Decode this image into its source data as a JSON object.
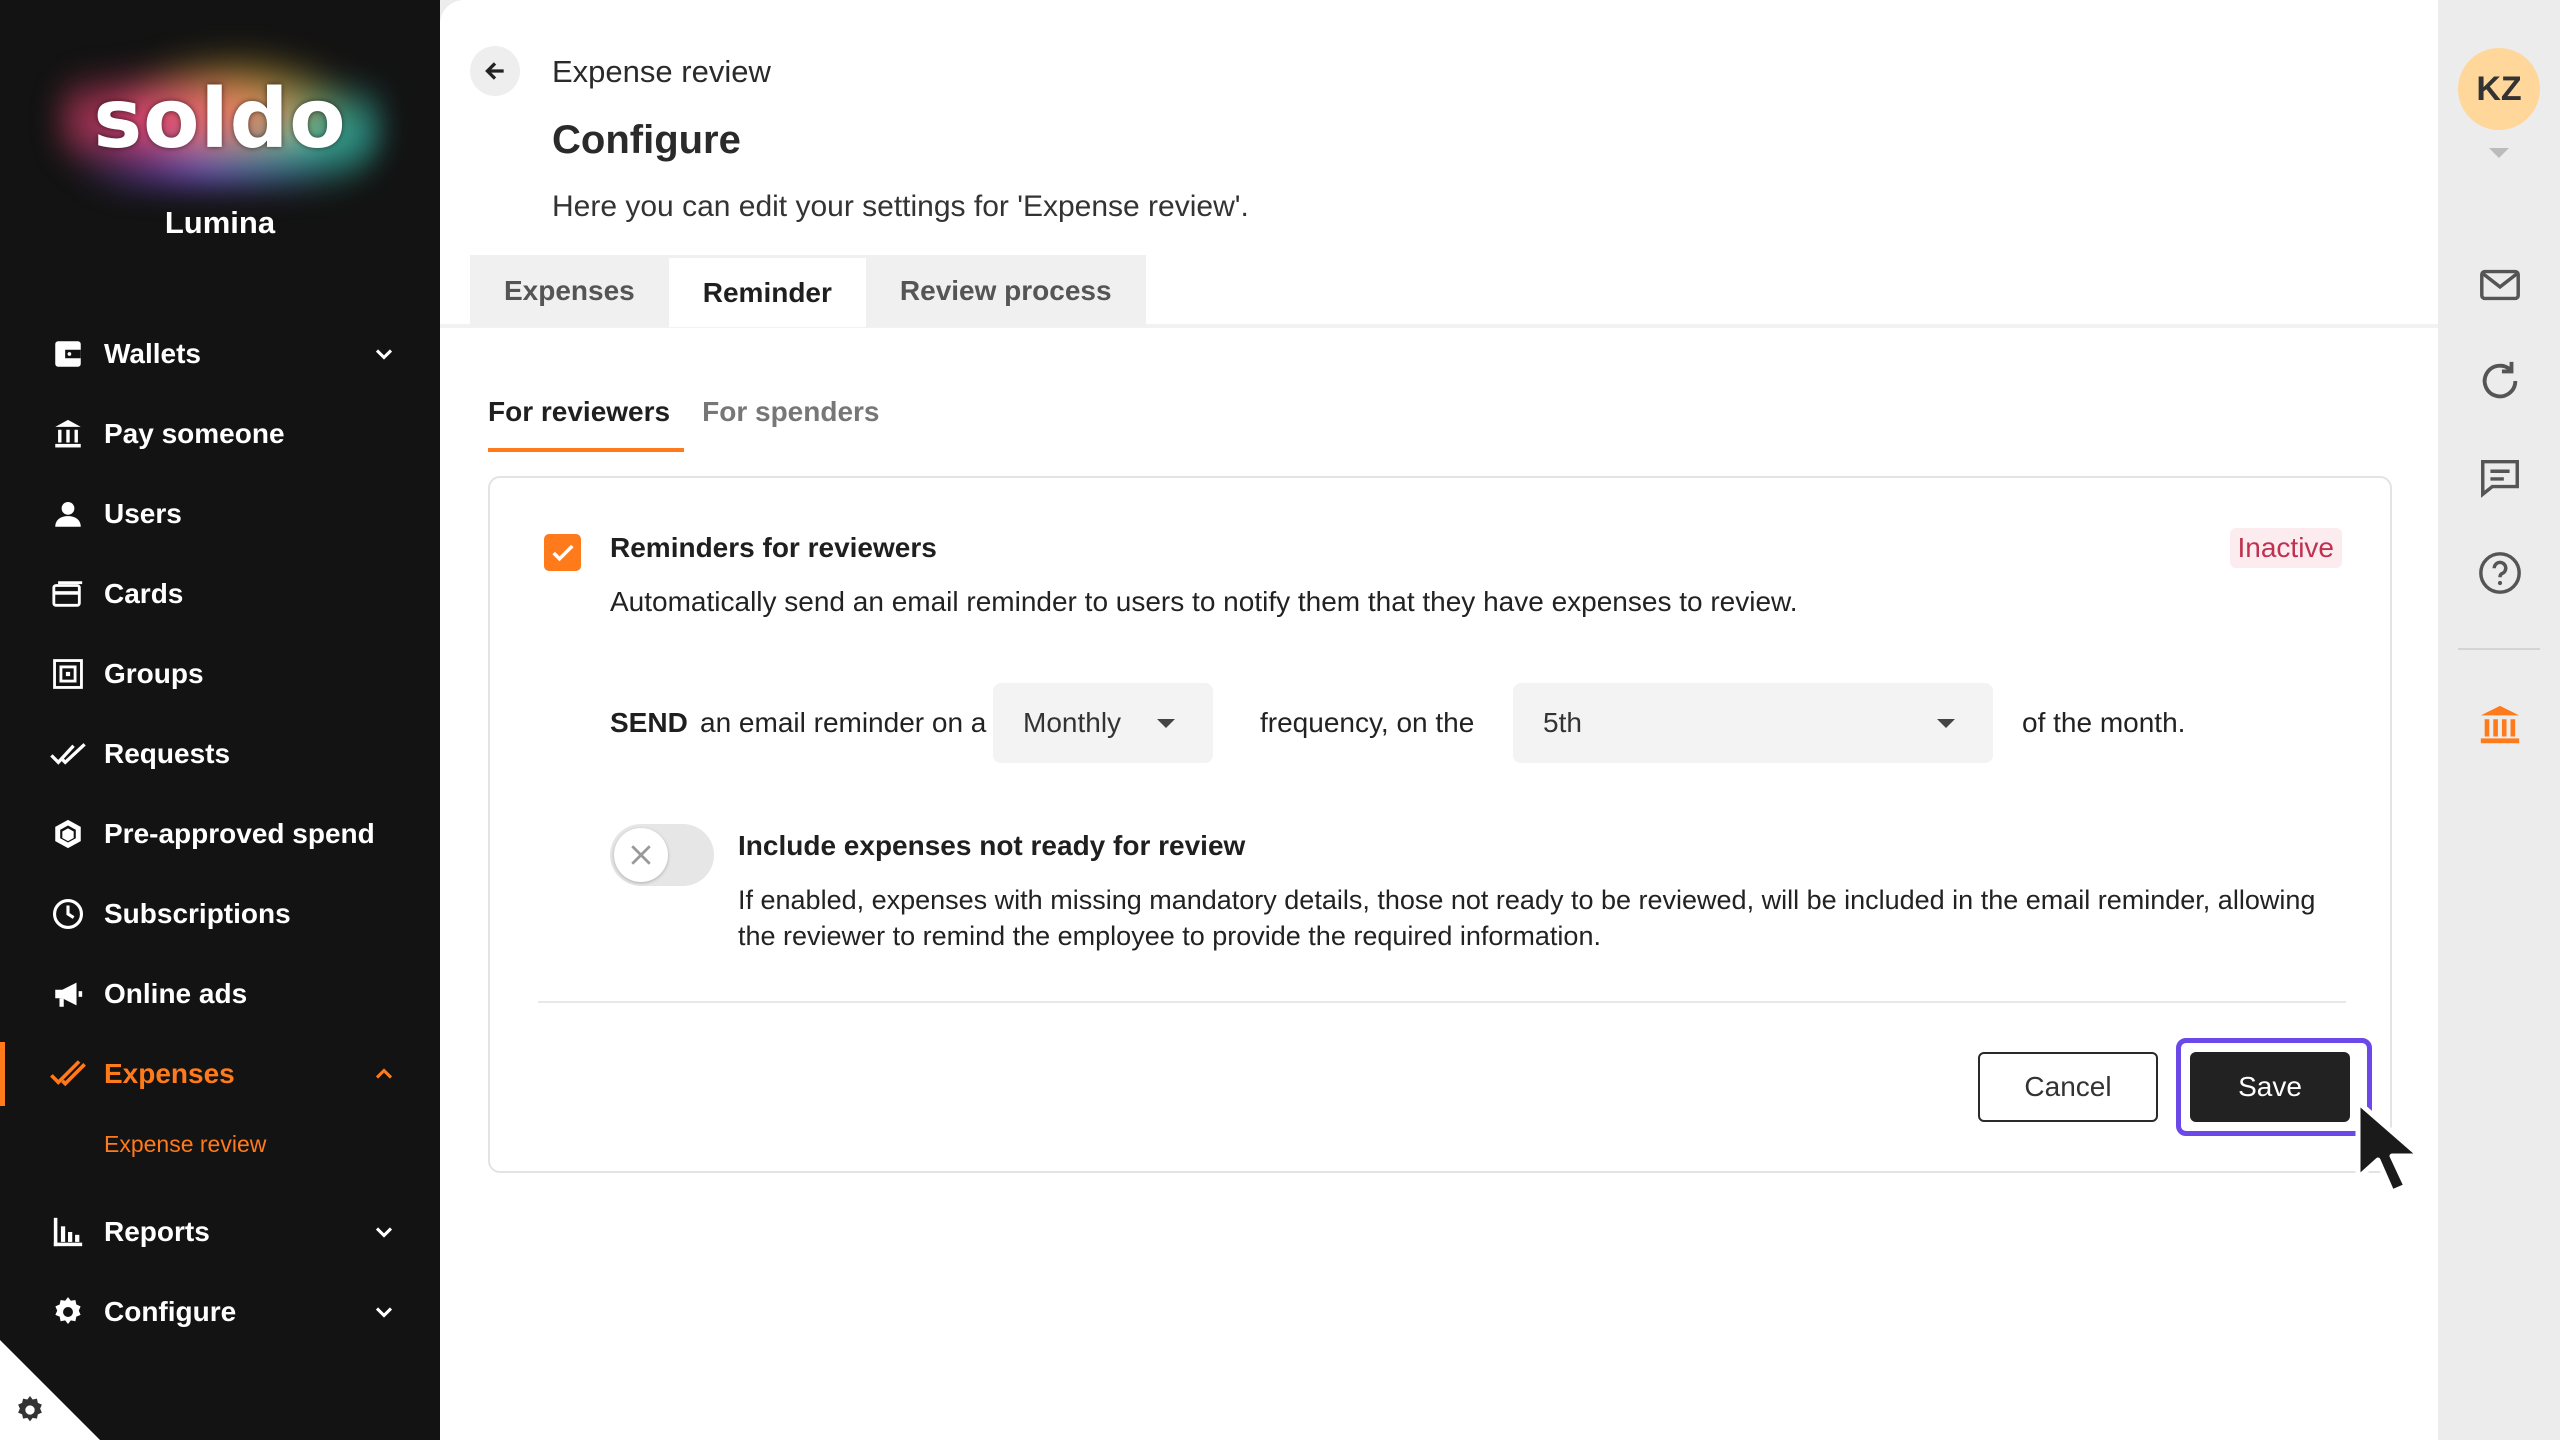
{
  "brand": {
    "logo_text": "soldo",
    "org_name": "Lumina"
  },
  "nav": {
    "items": [
      {
        "label": "Wallets",
        "icon": "wallet-icon"
      },
      {
        "label": "Pay someone",
        "icon": "bank-transfer-icon"
      },
      {
        "label": "Users",
        "icon": "user-icon"
      },
      {
        "label": "Cards",
        "icon": "cards-icon"
      },
      {
        "label": "Groups",
        "icon": "groups-icon"
      },
      {
        "label": "Requests",
        "icon": "requests-icon"
      },
      {
        "label": "Pre-approved spend",
        "icon": "shield-icon"
      },
      {
        "label": "Subscriptions",
        "icon": "clock-icon"
      },
      {
        "label": "Online ads",
        "icon": "megaphone-icon"
      },
      {
        "label": "Expenses",
        "icon": "check-icon"
      },
      {
        "label": "Reports",
        "icon": "bar-chart-icon"
      },
      {
        "label": "Configure",
        "icon": "gear-icon"
      }
    ],
    "sub_item": "Expense review",
    "active": "Expenses",
    "accent_color": "#ff7a1a"
  },
  "header": {
    "breadcrumb": "Expense review",
    "title": "Configure",
    "description": "Here you can edit your settings for 'Expense review'."
  },
  "tabs": [
    "Expenses",
    "Reminder",
    "Review process"
  ],
  "active_tab": "Reminder",
  "subtabs": [
    "For reviewers",
    "For spenders"
  ],
  "active_subtab": "For reviewers",
  "reminder": {
    "checked": true,
    "title": "Reminders for reviewers",
    "status": "Inactive",
    "description": "Automatically send an email reminder to users to notify them that they have expenses to review.",
    "send_word": "SEND",
    "send_text": "an email reminder on a",
    "frequency_value": "Monthly",
    "frequency_text": "frequency, on the",
    "day_value": "5th",
    "suffix_text": "of the month."
  },
  "include_toggle": {
    "enabled": false,
    "title": "Include expenses not ready for review",
    "description": "If enabled, expenses with missing mandatory details, those not ready to be reviewed, will be included in the email reminder, allowing the reviewer to remind the employee to provide the required information."
  },
  "actions": {
    "cancel_label": "Cancel",
    "save_label": "Save"
  },
  "user": {
    "initials": "KZ"
  },
  "rail_icons": [
    "mail-icon",
    "refresh-icon",
    "chat-icon",
    "help-icon",
    "bank-icon"
  ]
}
